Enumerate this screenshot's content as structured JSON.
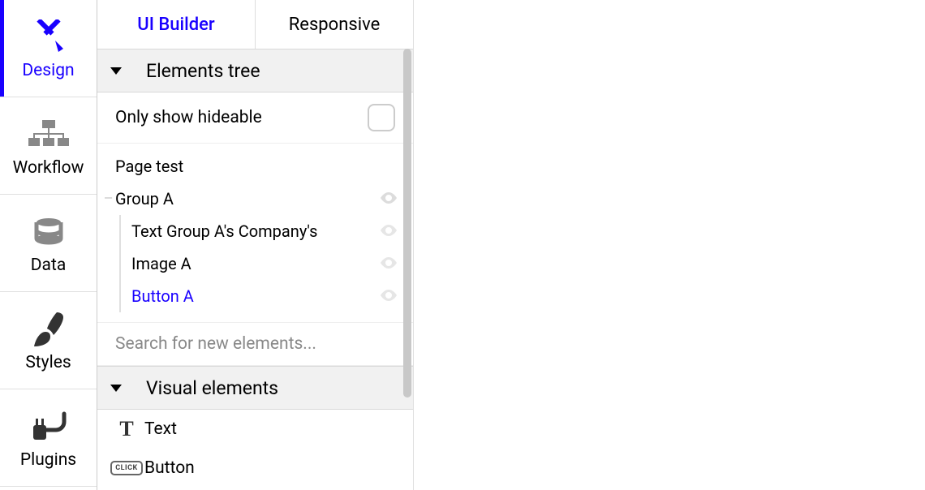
{
  "leftnav": {
    "design": "Design",
    "workflow": "Workflow",
    "data": "Data",
    "styles": "Styles",
    "plugins": "Plugins"
  },
  "tabs": {
    "uibuilder": "UI Builder",
    "responsive": "Responsive"
  },
  "sections": {
    "elements_tree": "Elements tree",
    "visual_elements": "Visual elements"
  },
  "hideable_label": "Only show hideable",
  "tree": {
    "page": "Page test",
    "group": "Group A",
    "text_company": "Text Group A's Company's",
    "image_a": "Image A",
    "button_a": "Button A"
  },
  "search_placeholder": "Search for new elements...",
  "elements": {
    "text": "Text",
    "button": "Button"
  },
  "click_badge": "CLICK"
}
